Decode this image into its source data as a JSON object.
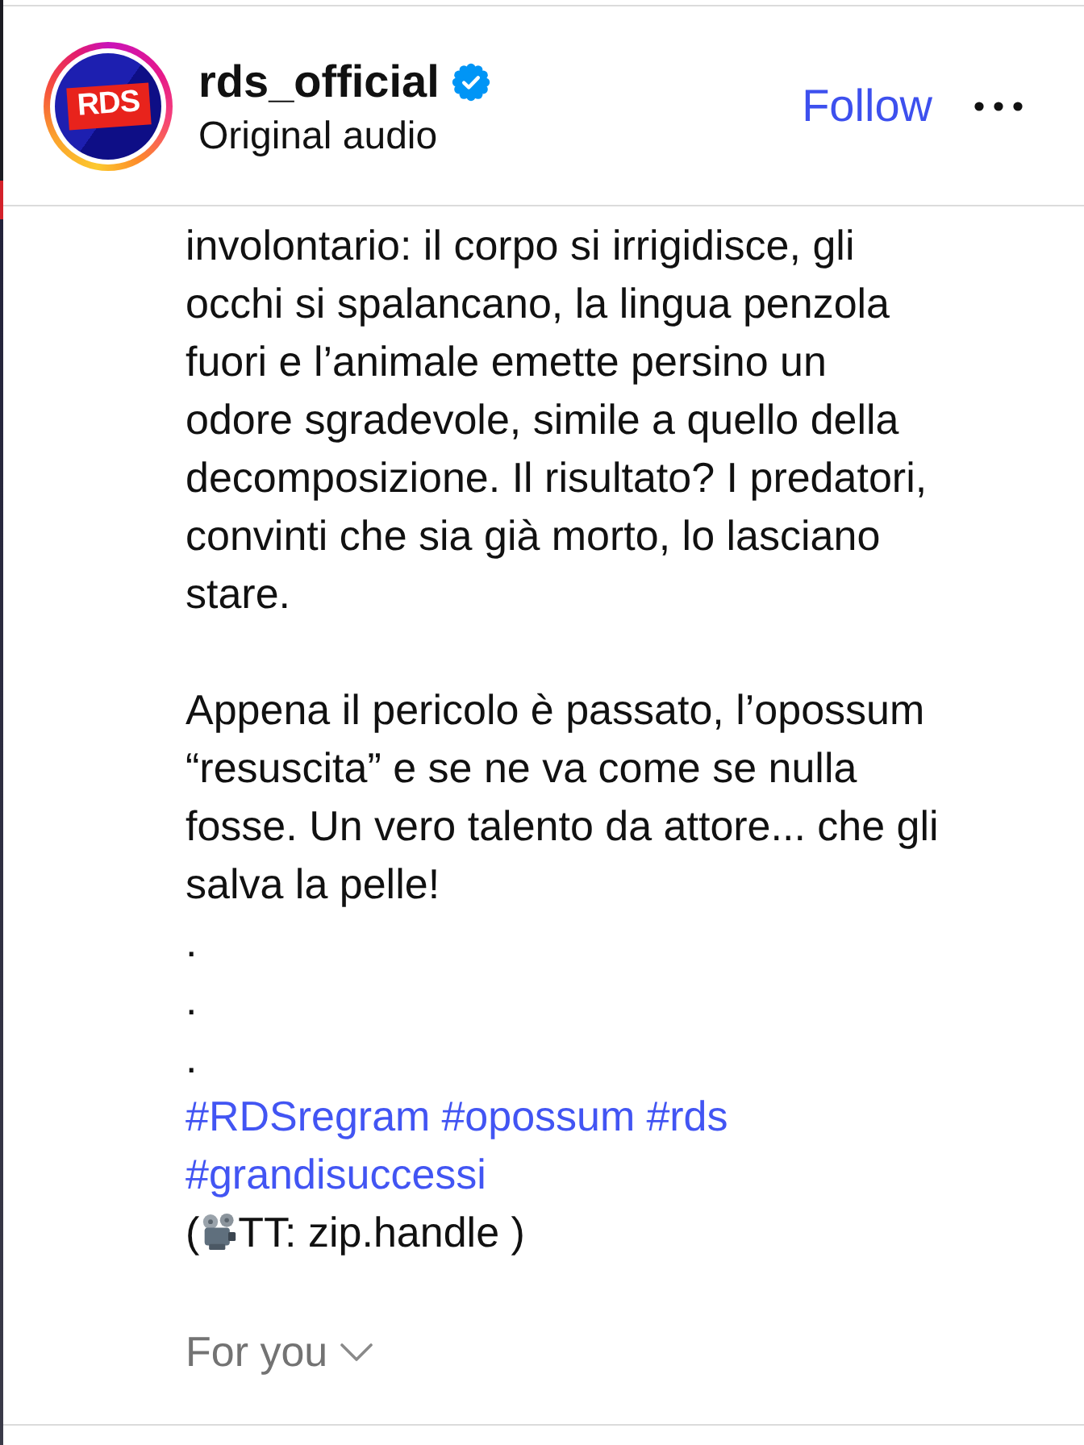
{
  "account": {
    "avatar_text": "RDS",
    "username": "rds_official",
    "verified": true,
    "subtitle": "Original audio",
    "follow_label": "Follow"
  },
  "caption": {
    "paragraphs": [
      "involontario: il corpo si irrigidisce, gli\nocchi si spalancano, la lingua penzola\nfuori e l’animale emette persino un\nodore sgradevole, simile a quello della\ndecomposizione. Il risultato? I predatori,\nconvinti che sia già morto, lo lasciano\nstare.",
      "Appena il pericolo è passato, l’opossum\n“resuscita” e se ne va come se nulla\nfosse. Un vero talento da attore... che gli\nsalva la pelle!"
    ],
    "dots": [
      ".",
      ".",
      "."
    ],
    "hashtags": [
      "#RDSregram",
      "#opossum",
      "#rds",
      "#grandisuccessi"
    ],
    "credit": {
      "before": "(",
      "after": "TT: zip.handle )"
    }
  },
  "feed_selector": {
    "label": "For you"
  }
}
